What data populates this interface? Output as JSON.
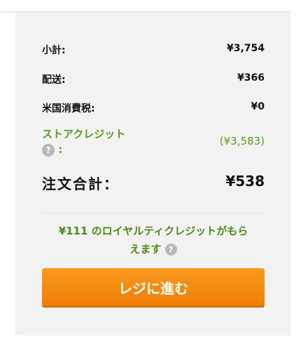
{
  "order_summary": {
    "subtotal": {
      "label": "小計:",
      "value": "¥3,754"
    },
    "shipping": {
      "label": "配送:",
      "value": "¥366"
    },
    "tax": {
      "label": "米国消費税:",
      "value": "¥0"
    },
    "store_credit": {
      "label_line1": "ストアクレジット",
      "label_suffix": ":",
      "value": "(¥3,583)"
    },
    "total": {
      "label": "注文合計：",
      "value": "¥538"
    }
  },
  "royalty_message": {
    "line1": "¥111 のロイヤルティクレジットがもら",
    "line2": "えます"
  },
  "checkout_button": {
    "label": "レジに進む"
  },
  "icons": {
    "help": "?"
  },
  "colors": {
    "panel_bg": "#f2f2f2",
    "credit_green": "#5a9a1a",
    "royalty_green": "#4e8c14",
    "button_orange": "#f5871a",
    "help_icon_gray": "#b8b8b8"
  }
}
